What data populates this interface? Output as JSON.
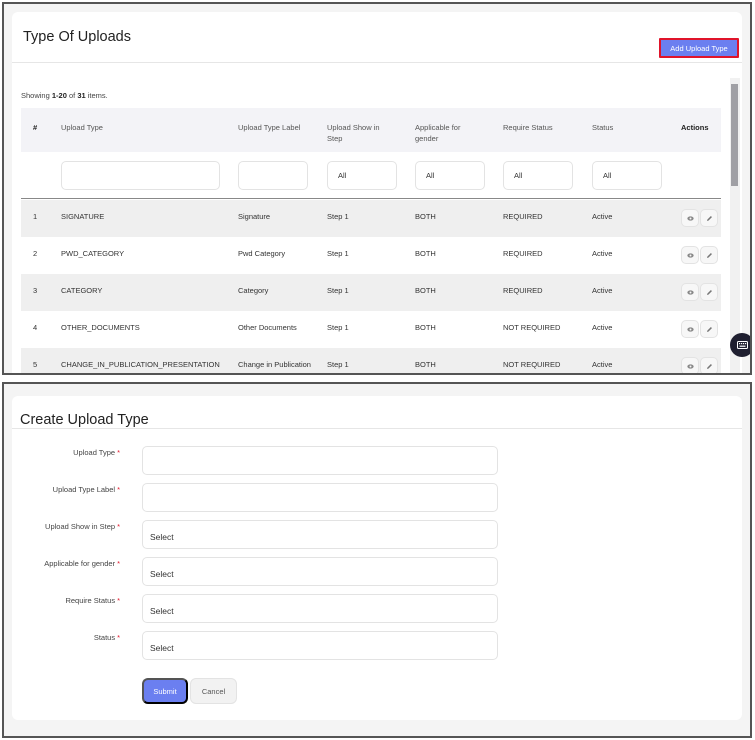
{
  "list_panel": {
    "title": "Type Of Uploads",
    "add_button": "Add Upload Type",
    "summary": {
      "prefix": "Showing ",
      "range": "1-20",
      "middle": " of ",
      "total": "31",
      "suffix": " items."
    },
    "columns": [
      "#",
      "Upload Type",
      "Upload Type Label",
      "Upload Show in Step",
      "Applicable for gender",
      "Require Status",
      "Status",
      "Actions"
    ],
    "filters": {
      "upload_type": "",
      "upload_type_label": "",
      "upload_show_in_step": "All",
      "applicable_for_gender": "All",
      "require_status": "All",
      "status": "All"
    },
    "rows": [
      {
        "num": "1",
        "upload_type": "SIGNATURE",
        "label": "Signature",
        "step": "Step 1",
        "gender": "BOTH",
        "require": "REQUIRED",
        "status": "Active"
      },
      {
        "num": "2",
        "upload_type": "PWD_CATEGORY",
        "label": "Pwd Category",
        "step": "Step 1",
        "gender": "BOTH",
        "require": "REQUIRED",
        "status": "Active"
      },
      {
        "num": "3",
        "upload_type": "CATEGORY",
        "label": "Category",
        "step": "Step 1",
        "gender": "BOTH",
        "require": "REQUIRED",
        "status": "Active"
      },
      {
        "num": "4",
        "upload_type": "OTHER_DOCUMENTS",
        "label": "Other Documents",
        "step": "Step 1",
        "gender": "BOTH",
        "require": "NOT REQUIRED",
        "status": "Active"
      },
      {
        "num": "5",
        "upload_type": "CHANGE_IN_PUBLICATION_PRESENTATION",
        "label": "Change in Publication",
        "step": "Step 1",
        "gender": "BOTH",
        "require": "NOT REQUIRED",
        "status": "Active"
      }
    ],
    "action_icons": [
      "eye-icon",
      "pencil-icon"
    ]
  },
  "form_panel": {
    "title": "Create Upload Type",
    "required_mark": "*",
    "fields": [
      {
        "label": "Upload Type",
        "value": "",
        "placeholder": ""
      },
      {
        "label": "Upload Type Label",
        "value": "",
        "placeholder": ""
      },
      {
        "label": "Upload Show in Step",
        "value": "Select"
      },
      {
        "label": "Applicable for gender",
        "value": "Select"
      },
      {
        "label": "Require Status",
        "value": "Select"
      },
      {
        "label": "Status",
        "value": "Select"
      }
    ],
    "submit": "Submit",
    "cancel": "Cancel"
  },
  "colors": {
    "primary": "#6b7ff0",
    "highlight_border": "#e0142a",
    "required": "#e0142a"
  }
}
